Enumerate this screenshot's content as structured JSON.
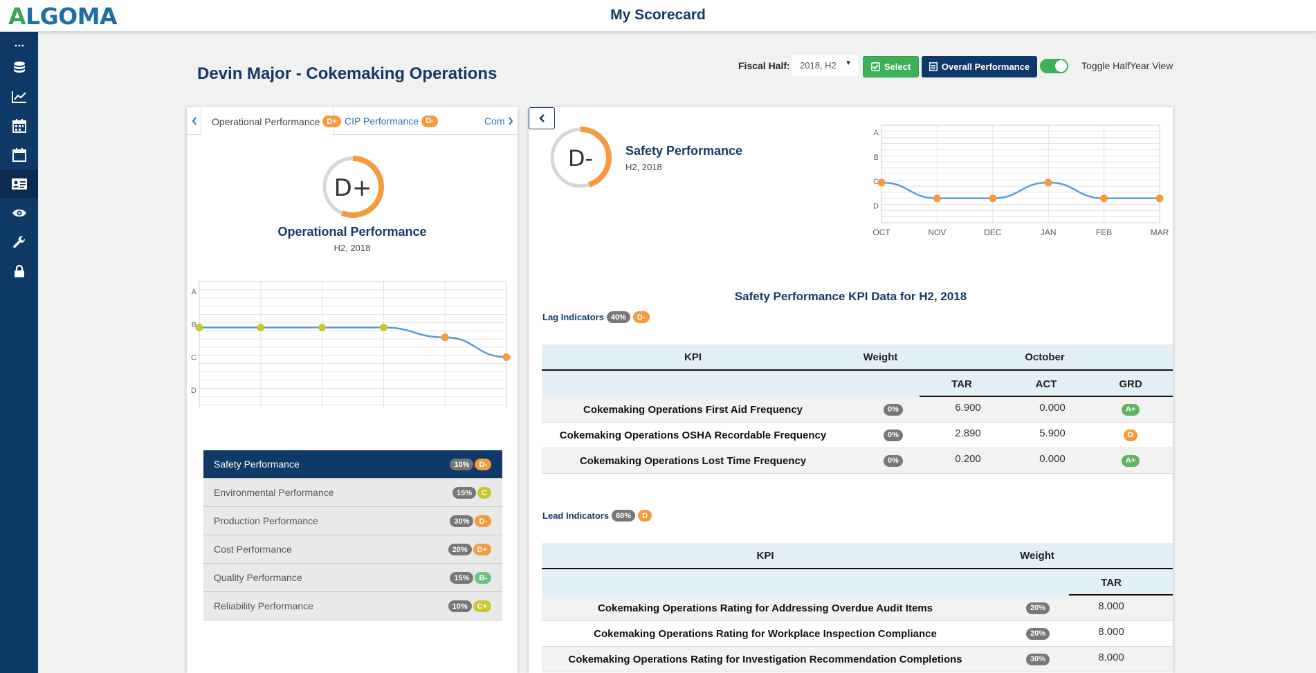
{
  "header": {
    "logo": "ALGOMA",
    "title": "My Scorecard"
  },
  "sidebar": {
    "icons": [
      "more-icon",
      "database-icon",
      "line-chart-icon",
      "calendar-icon",
      "calendar-check-icon",
      "id-card-icon",
      "eye-icon",
      "wrench-icon",
      "lock-icon"
    ],
    "active_index": 5
  },
  "page": {
    "title": "Devin Major - Cokemaking Operations"
  },
  "controls": {
    "fiscal_half_label": "Fiscal Half:",
    "fiscal_half_value": "2018, H2",
    "select_label": "Select",
    "overall_label": "Overall Performance",
    "toggle_label": "Toggle HalfYear View",
    "toggle_on": true
  },
  "left_panel": {
    "tabs": [
      {
        "label": "Operational Performance",
        "grade": "D+",
        "grade_color": "#f59a3d",
        "active": true
      },
      {
        "label": "CIP Performance",
        "grade": "D-",
        "grade_color": "#f59a3d",
        "active": false
      },
      {
        "label": "Com",
        "grade": "",
        "grade_color": "",
        "active": false
      }
    ],
    "score": {
      "grade": "D+",
      "title": "Operational Performance",
      "period": "H2, 2018",
      "ring_fill_fraction": 0.56,
      "ring_color": "#f59a3d"
    },
    "list": [
      {
        "label": "Safety Performance",
        "weight": "10%",
        "grade": "D-",
        "grade_color": "#f59a3d",
        "active": true
      },
      {
        "label": "Environmental Performance",
        "weight": "15%",
        "grade": "C",
        "grade_color": "#c9c82c",
        "active": false
      },
      {
        "label": "Production Performance",
        "weight": "30%",
        "grade": "D-",
        "grade_color": "#f59a3d",
        "active": false
      },
      {
        "label": "Cost Performance",
        "weight": "20%",
        "grade": "D+",
        "grade_color": "#f59a3d",
        "active": false
      },
      {
        "label": "Quality Performance",
        "weight": "15%",
        "grade": "B-",
        "grade_color": "#6cc383",
        "active": false
      },
      {
        "label": "Reliability Performance",
        "weight": "10%",
        "grade": "C+",
        "grade_color": "#c9c82c",
        "active": false
      }
    ]
  },
  "right_panel": {
    "score": {
      "grade": "D-",
      "title": "Safety Performance",
      "period": "H2, 2018",
      "ring_fill_fraction": 0.45,
      "ring_color": "#f59a3d"
    },
    "kpi_title": "Safety Performance KPI Data for H2, 2018",
    "lag": {
      "label": "Lag Indicators",
      "weight": "40%",
      "grade": "D-",
      "grade_color": "#f59a3d",
      "headers": {
        "kpi": "KPI",
        "weight": "Weight",
        "month": "October",
        "tar": "TAR",
        "act": "ACT",
        "grd": "GRD"
      },
      "rows": [
        {
          "name": "Cokemaking Operations First Aid Frequency",
          "weight": "0%",
          "tar": "6.900",
          "act": "0.000",
          "grd": "A+",
          "grd_color": "#5db55c"
        },
        {
          "name": "Cokemaking Operations OSHA Recordable Frequency",
          "weight": "0%",
          "tar": "2.890",
          "act": "5.900",
          "grd": "D",
          "grd_color": "#f59a3d"
        },
        {
          "name": "Cokemaking Operations Lost Time Frequency",
          "weight": "0%",
          "tar": "0.200",
          "act": "0.000",
          "grd": "A+",
          "grd_color": "#5db55c"
        }
      ]
    },
    "lead": {
      "label": "Lead Indicators",
      "weight": "60%",
      "grade": "D",
      "grade_color": "#f59a3d",
      "headers": {
        "kpi": "KPI",
        "weight": "Weight",
        "tar": "TAR"
      },
      "rows": [
        {
          "name": "Cokemaking Operations Rating for Addressing Overdue Audit Items",
          "weight": "20%",
          "tar": "8.000"
        },
        {
          "name": "Cokemaking Operations Rating for Workplace Inspection Compliance",
          "weight": "20%",
          "tar": "8.000"
        },
        {
          "name": "Cokemaking Operations Rating for Investigation Recommendation Completions",
          "weight": "30%",
          "tar": "8.000"
        }
      ]
    }
  },
  "chart_data": [
    {
      "type": "line",
      "title": "",
      "categories": [
        "OCT",
        "NOV",
        "DEC",
        "JAN",
        "FEB",
        "MAR"
      ],
      "y_levels": [
        "A",
        "B",
        "C",
        "D"
      ],
      "ylim": [
        0,
        4
      ],
      "series": [
        {
          "values": [
            2.6,
            2.6,
            2.6,
            2.6,
            2.3,
            1.7
          ]
        }
      ],
      "point_colors": [
        "#c9c82c",
        "#c9c82c",
        "#c9c82c",
        "#c9c82c",
        "#f59a3d",
        "#f59a3d"
      ],
      "line_color": "#5b9bd5",
      "grid": true
    },
    {
      "type": "line",
      "title": "",
      "categories": [
        "OCT",
        "NOV",
        "DEC",
        "JAN",
        "FEB",
        "MAR"
      ],
      "y_levels": [
        "A",
        "B",
        "C",
        "D"
      ],
      "ylim": [
        0,
        4
      ],
      "series": [
        {
          "values": [
            1.65,
            1.0,
            1.0,
            1.65,
            1.0,
            1.0
          ]
        }
      ],
      "point_colors": [
        "#f59a3d",
        "#f59a3d",
        "#f59a3d",
        "#f59a3d",
        "#f59a3d",
        "#f59a3d"
      ],
      "line_color": "#5b9bd5",
      "grid": true
    }
  ]
}
